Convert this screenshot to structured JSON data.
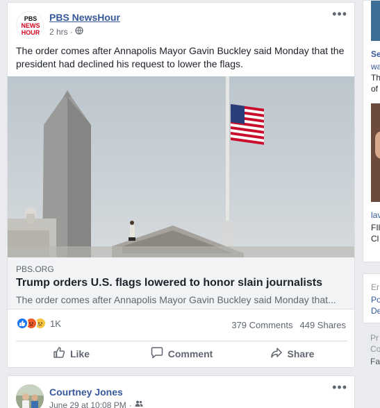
{
  "post1": {
    "page_name": "PBS NewsHour",
    "avatar_text": [
      "PBS",
      "NEWS",
      "HOUR"
    ],
    "time": "2 hrs",
    "visibility_icon": "globe-icon",
    "more_label": "•••",
    "text": "The order comes after Annapolis Mayor Gavin Buckley said Monday that the president had declined his request to lower the flags.",
    "link": {
      "domain": "PBS.ORG",
      "title": "Trump orders U.S. flags lowered to honor slain journalists",
      "description": "The order comes after Annapolis Mayor Gavin Buckley said Monday that..."
    },
    "reactions": {
      "icons": [
        "like",
        "angry",
        "sad"
      ],
      "count": "1K"
    },
    "comments": "379 Comments",
    "shares": "449 Shares",
    "actions": {
      "like": "Like",
      "comment": "Comment",
      "share": "Share"
    }
  },
  "post2": {
    "name": "Courtney Jones",
    "time": "June 29 at 10:08 PM",
    "audience_icon": "friends-icon",
    "more_label": "•••"
  },
  "sidebar": {
    "card1": [
      "Se",
      "wa",
      "Th",
      "of"
    ],
    "card1_more": [
      "lav",
      "FIl",
      "Cl"
    ],
    "card2": [
      "Er",
      "Po",
      "De"
    ],
    "card3": [
      "Pr",
      "Co",
      "Fa"
    ]
  },
  "colors": {
    "link_blue": "#365899",
    "like_blue": "#1877f2",
    "pbs_red": "#d0021b"
  }
}
